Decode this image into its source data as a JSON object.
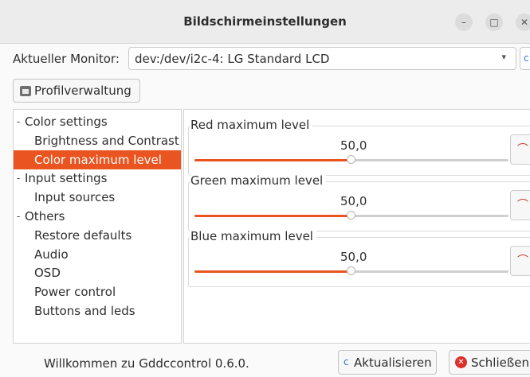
{
  "window": {
    "title": "Bildschirmeinstellungen",
    "minimize_glyph": "–",
    "maximize_glyph": "□",
    "close_glyph": "✕"
  },
  "monitor": {
    "label": "Aktueller Monitor:",
    "value": "dev:/dev/i2c-4: LG Standard LCD",
    "dropdown_glyph": "▾",
    "refresh_glyph": "c"
  },
  "profile_button": {
    "label": "Profilverwaltung",
    "icon": "profile-manager-icon"
  },
  "tree": {
    "expander_glyph": "-",
    "items": [
      {
        "label": "Color settings",
        "level": 0,
        "expanded": true,
        "selected": false
      },
      {
        "label": "Brightness and Contrast",
        "level": 1,
        "selected": false
      },
      {
        "label": "Color maximum level",
        "level": 1,
        "selected": true
      },
      {
        "label": "Input settings",
        "level": 0,
        "expanded": true,
        "selected": false
      },
      {
        "label": "Input sources",
        "level": 1,
        "selected": false
      },
      {
        "label": "Others",
        "level": 0,
        "expanded": true,
        "selected": false
      },
      {
        "label": "Restore defaults",
        "level": 1,
        "selected": false
      },
      {
        "label": "Audio",
        "level": 1,
        "selected": false
      },
      {
        "label": "OSD",
        "level": 1,
        "selected": false
      },
      {
        "label": "Power control",
        "level": 1,
        "selected": false
      },
      {
        "label": "Buttons and leds",
        "level": 1,
        "selected": false
      }
    ]
  },
  "controls": [
    {
      "title": "Red maximum level",
      "value_text": "50,0",
      "fraction": 0.5,
      "reset_glyph": "⌒"
    },
    {
      "title": "Green maximum level",
      "value_text": "50,0",
      "fraction": 0.5,
      "reset_glyph": "⌒"
    },
    {
      "title": "Blue maximum level",
      "value_text": "50,0",
      "fraction": 0.5,
      "reset_glyph": "⌒"
    }
  ],
  "status": {
    "text": "Willkommen zu Gddccontrol 0.6.0."
  },
  "footer": {
    "refresh": {
      "label": "Aktualisieren",
      "glyph": "c"
    },
    "close": {
      "label": "Schließen",
      "glyph": "✕"
    }
  },
  "colors": {
    "accent": "#e95420",
    "close_red": "#d9302b",
    "refresh_blue": "#2d7bd6"
  }
}
